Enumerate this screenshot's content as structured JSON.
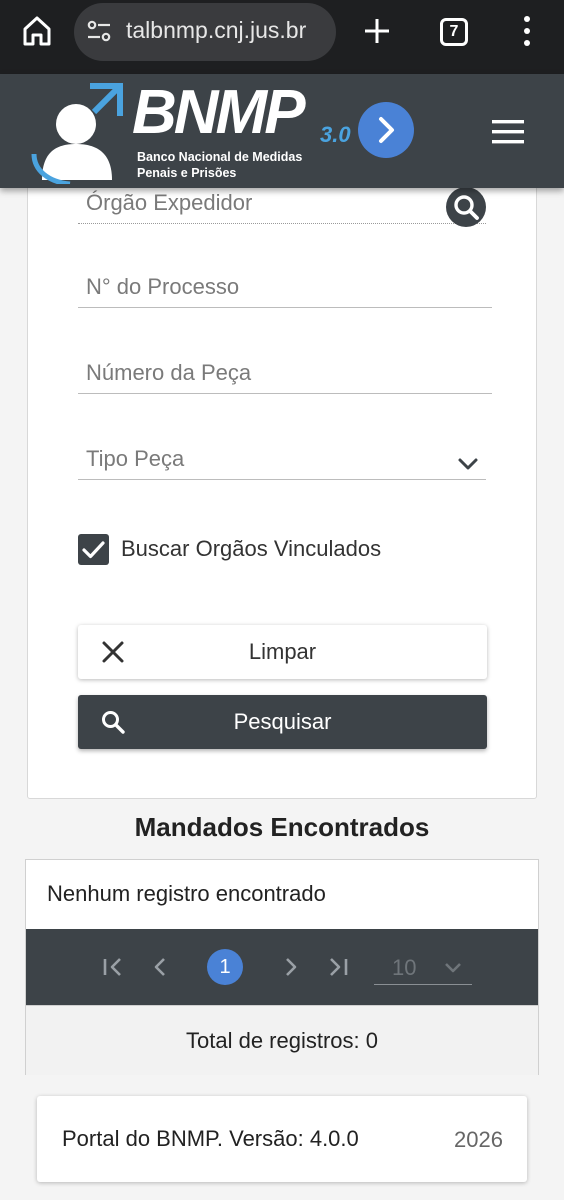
{
  "browser": {
    "url": "talbnmp.cnj.jus.br",
    "tab_count": "7"
  },
  "header": {
    "logo_text": "BNMP",
    "logo_version": "3.0",
    "logo_subtitle_line1": "Banco Nacional de Medidas",
    "logo_subtitle_line2": "Penais e Prisões"
  },
  "form": {
    "orgao_expedidor_label": "Órgão Expedidor",
    "processo_label": "N° do Processo",
    "numero_peca_label": "Número da Peça",
    "tipo_peca_label": "Tipo Peça",
    "buscar_vinculados_label": "Buscar Orgãos Vinculados",
    "buscar_vinculados_checked": true,
    "clear_button": "Limpar",
    "search_button": "Pesquisar"
  },
  "results": {
    "title": "Mandados Encontrados",
    "empty_message": "Nenhum registro encontrado",
    "current_page": "1",
    "rows_per_page": "10",
    "total_text": "Total de registros: 0"
  },
  "footer": {
    "version_text": "Portal do BNMP. Versão: 4.0.0",
    "year": "2026"
  },
  "colors": {
    "header_bg": "#3d4348",
    "accent_blue": "#4a82d6",
    "logo_blue": "#4aa3df"
  }
}
